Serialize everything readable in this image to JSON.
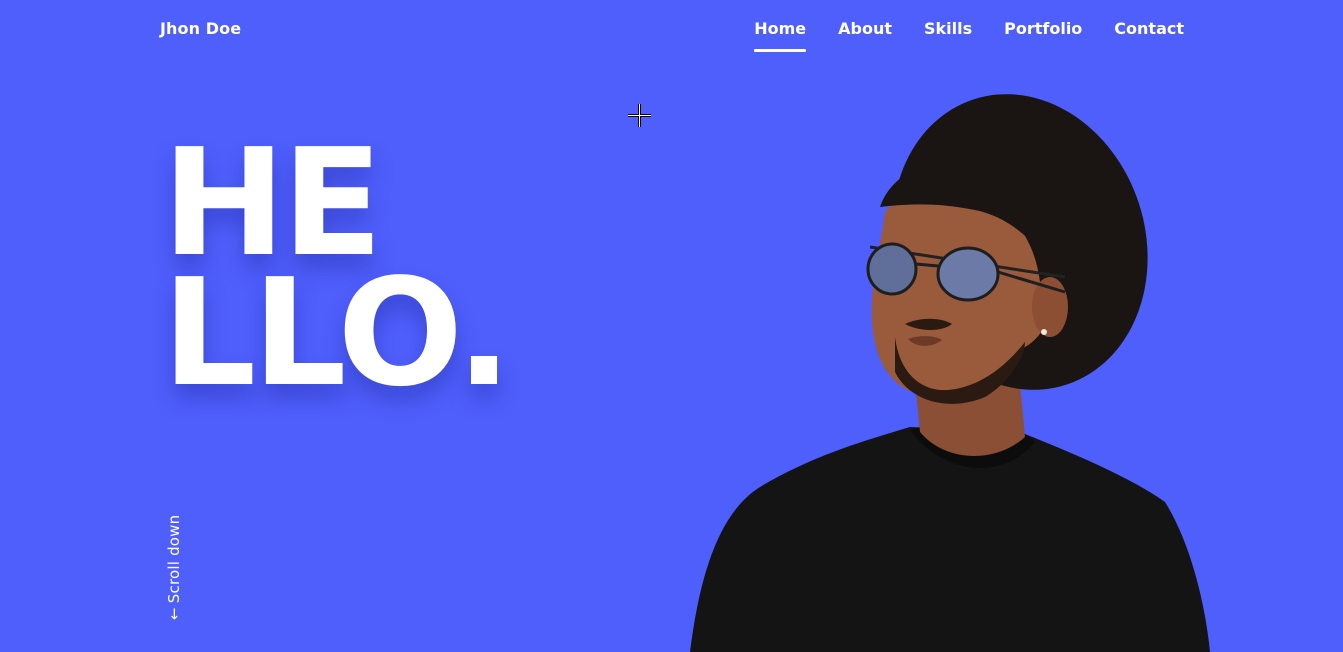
{
  "header": {
    "brand": "Jhon Doe",
    "nav": [
      {
        "label": "Home",
        "active": true
      },
      {
        "label": "About",
        "active": false
      },
      {
        "label": "Skills",
        "active": false
      },
      {
        "label": "Portfolio",
        "active": false
      },
      {
        "label": "Contact",
        "active": false
      }
    ]
  },
  "hero": {
    "line1": "HE",
    "line2": "LLO.",
    "scroll_label": "Scroll down",
    "scroll_icon": "arrow-down-icon",
    "photo_icon": "person-photo"
  },
  "colors": {
    "background": "#4f5ffc",
    "text": "#ffffff",
    "shirt": "#141414",
    "hat": "#1a1412",
    "skin": "#9a5a3c"
  }
}
